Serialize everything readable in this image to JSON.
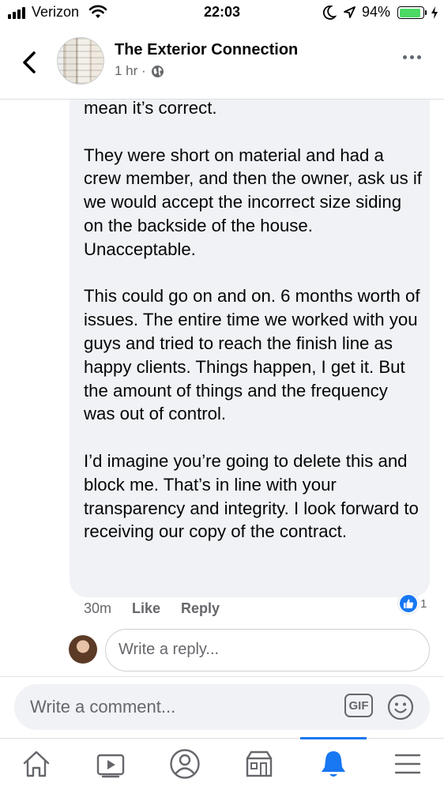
{
  "status_bar": {
    "carrier": "Verizon",
    "time": "22:03",
    "battery_percent": "94%",
    "battery_level": 0.94,
    "signal_bars": 4,
    "battery_color": "#4cd964"
  },
  "header": {
    "back_icon": "chevron-left-icon",
    "page_name": "The Exterior Connection",
    "post_time": "1 hr ·",
    "privacy_icon": "globe-icon",
    "more_icon": "ellipsis-icon"
  },
  "comment": {
    "text": "mean it’s correct.\n\nThey were short on material and had a crew member, and then the owner, ask us if we would accept the incorrect size siding on the backside of the house. Unacceptable.\n\nThis could go on and on. 6 months worth of issues. The entire time we worked with you guys and tried to reach the finish line as happy clients. Things happen, I get it. But the amount of things and the frequency was out of control.\n\nI’d imagine you’re going to delete this and block me. That’s in line with your transparency and integrity. I look forward to receiving our copy of the contract.",
    "time_ago": "30m",
    "like_label": "Like",
    "reply_label": "Reply",
    "reaction_count": "1",
    "reaction_icon": "thumbs-up-icon"
  },
  "reply": {
    "placeholder": "Write a reply..."
  },
  "composer": {
    "placeholder": "Write a comment...",
    "gif_label": "GIF",
    "emoji_icon": "smiley-icon"
  },
  "bottom_nav": {
    "items": [
      "home-icon",
      "watch-icon",
      "profile-icon",
      "marketplace-icon",
      "notifications-icon",
      "menu-icon"
    ],
    "active": "notifications-icon",
    "accent": "#1877f2"
  }
}
